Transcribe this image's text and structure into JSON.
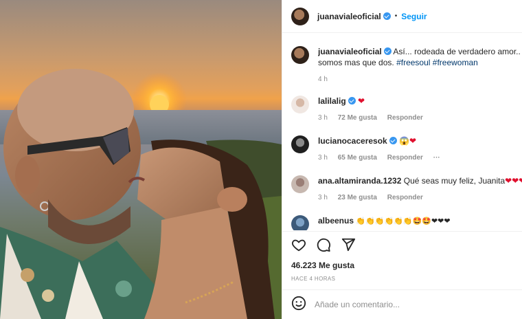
{
  "header": {
    "username": "juanavialeoficial",
    "dot": "•",
    "follow_label": "Seguir"
  },
  "caption": {
    "username": "juanavialeoficial",
    "text_before": "Así... rodeada de verdadero amor.... nosotros somos mas que dos.",
    "line1": "Así... rodeada de verdadero amor.... noso",
    "line2": "somos mas que dos.",
    "hashtag1": "#freesoul",
    "hashtag2": "#freewoman",
    "time": "4 h"
  },
  "comments": [
    {
      "username": "lalilalig",
      "text": "",
      "emojis": "❤",
      "time": "3 h",
      "likes": "72 Me gusta",
      "reply": "Responder",
      "more": ""
    },
    {
      "username": "lucianocaceresok",
      "text": "",
      "emojis": "😱❤",
      "time": "3 h",
      "likes": "65 Me gusta",
      "reply": "Responder",
      "more": "···"
    },
    {
      "username": "ana.altamiranda.1232",
      "text": "Qué seas muy feliz, Juanita",
      "emojis": "❤❤❤❤",
      "time": "3 h",
      "likes": "23 Me gusta",
      "reply": "Responder",
      "more": ""
    },
    {
      "username": "albeenus",
      "text": "",
      "emojis": "👏👏👏👏👏👏🤩🤩❤❤❤",
      "time": "",
      "likes": "",
      "reply": "",
      "more": ""
    }
  ],
  "actions": {
    "like_icon": "heart-outline-icon",
    "comment_icon": "comment-bubble-icon",
    "share_icon": "paper-plane-icon",
    "likes_count": "46.223 Me gusta",
    "posted_ago": "HACE 4 HORAS"
  },
  "add_comment": {
    "emoji_icon": "smiley-icon",
    "placeholder": "Añade un comentario..."
  },
  "colors": {
    "accent": "#0095f6",
    "verified": "#3897f0",
    "heart": "#e0102e",
    "muted": "#8e8e8e"
  }
}
